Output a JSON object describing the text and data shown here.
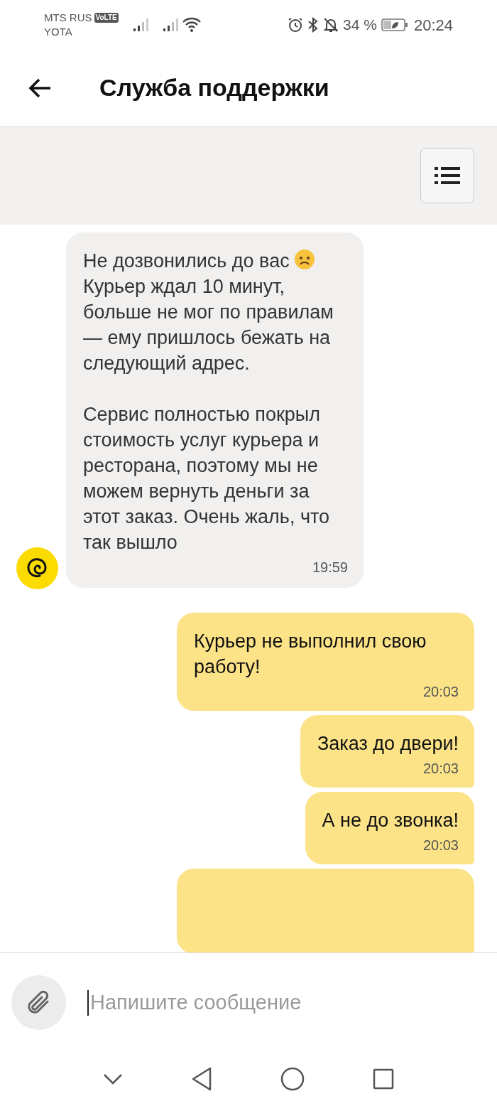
{
  "status_bar": {
    "carrier_1": "MTS RUS",
    "volte": "VoLTE",
    "carrier_2": "YOTA",
    "battery": "34 %",
    "time": "20:24"
  },
  "header": {
    "title": "Служба поддержки"
  },
  "messages": [
    {
      "kind": "incoming",
      "parts": [
        {
          "kind": "text",
          "text": "Не дозвонились до вас"
        },
        {
          "kind": "emoji"
        },
        {
          "kind": "break"
        },
        {
          "kind": "text",
          "text": "Курьер ждал 10 минут, больше не мог по правилам — ему пришлось бежать на следующий адрес."
        },
        {
          "kind": "gap"
        },
        {
          "kind": "text",
          "text": "Сервис полностью покрыл стоимость услуг курьера и ресторана, поэтому мы не можем вернуть деньги за этот заказ. Очень жаль, что так вышло"
        }
      ],
      "time": "19:59"
    },
    {
      "kind": "outgoing",
      "parts": [
        {
          "kind": "text",
          "text": "Курьер не выполнил свою работу!"
        }
      ],
      "time": "20:03"
    },
    {
      "kind": "outgoing",
      "parts": [
        {
          "kind": "text",
          "text": "Заказ до двери!"
        }
      ],
      "time": "20:03"
    },
    {
      "kind": "outgoing",
      "parts": [
        {
          "kind": "text",
          "text": "А не до звонка!"
        }
      ],
      "time": "20:03"
    },
    {
      "kind": "outgoing"
    }
  ],
  "composer": {
    "placeholder": "Напишите сообщение"
  }
}
